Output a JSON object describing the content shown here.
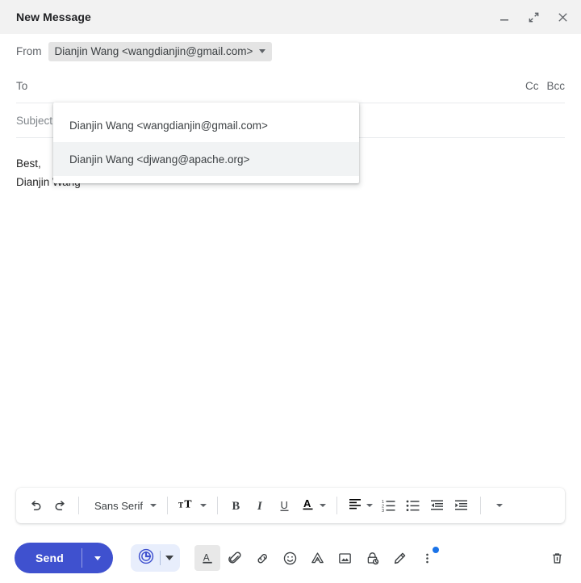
{
  "window": {
    "title": "New Message",
    "controls": [
      {
        "name": "minimize",
        "label": "Minimize"
      },
      {
        "name": "expand",
        "label": "Full screen"
      },
      {
        "name": "close",
        "label": "Save & close"
      }
    ]
  },
  "fields": {
    "from": {
      "label": "From",
      "value": "Dianjin Wang <wangdianjin@gmail.com>",
      "expanded": true
    },
    "to": {
      "label": "To",
      "value": "",
      "placeholder": "To"
    },
    "cc_label": "Cc",
    "bcc_label": "Bcc",
    "subject": {
      "label": "Subject",
      "value": "",
      "placeholder": "Subject"
    }
  },
  "from_dropdown": {
    "options": [
      {
        "label": "Dianjin Wang <wangdianjin@gmail.com>",
        "selected": false
      },
      {
        "label": "Dianjin Wang <djwang@apache.org>",
        "selected": true
      }
    ]
  },
  "body": {
    "lines": [
      "Best,",
      "Dianjin Wang"
    ]
  },
  "format_toolbar": {
    "undo_label": "Undo",
    "redo_label": "Redo",
    "font_name": "Sans Serif",
    "size_label": "Size",
    "bold_label": "Bold",
    "italic_label": "Italic",
    "underline_label": "Underline",
    "text_color_label": "Text color",
    "align_label": "Align",
    "numbered_list_label": "Numbered list",
    "bulleted_list_label": "Bulleted list",
    "indent_less_label": "Indent less",
    "indent_more_label": "Indent more",
    "more_format_label": "More formatting options"
  },
  "send_bar": {
    "send_label": "Send",
    "send_options_label": "More send options",
    "assist_label": "Schedule",
    "assist_caret_label": "Schedule options",
    "formatting_label": "Formatting options",
    "attach_label": "Attach files",
    "link_label": "Insert link",
    "emoji_label": "Insert emoji",
    "drive_label": "Insert files using Drive",
    "photo_label": "Insert photo",
    "confidential_label": "Toggle confidential mode",
    "signature_label": "Insert signature",
    "more_options_label": "More options",
    "discard_label": "Discard draft"
  },
  "colors": {
    "header_bg": "#f2f2f2",
    "send_blue": "#3f51cf",
    "assist_bg": "#e8eefc",
    "notification_dot": "#1a73e8",
    "chip_bg": "#e4e4e4",
    "selected_row": "#f1f3f4"
  }
}
